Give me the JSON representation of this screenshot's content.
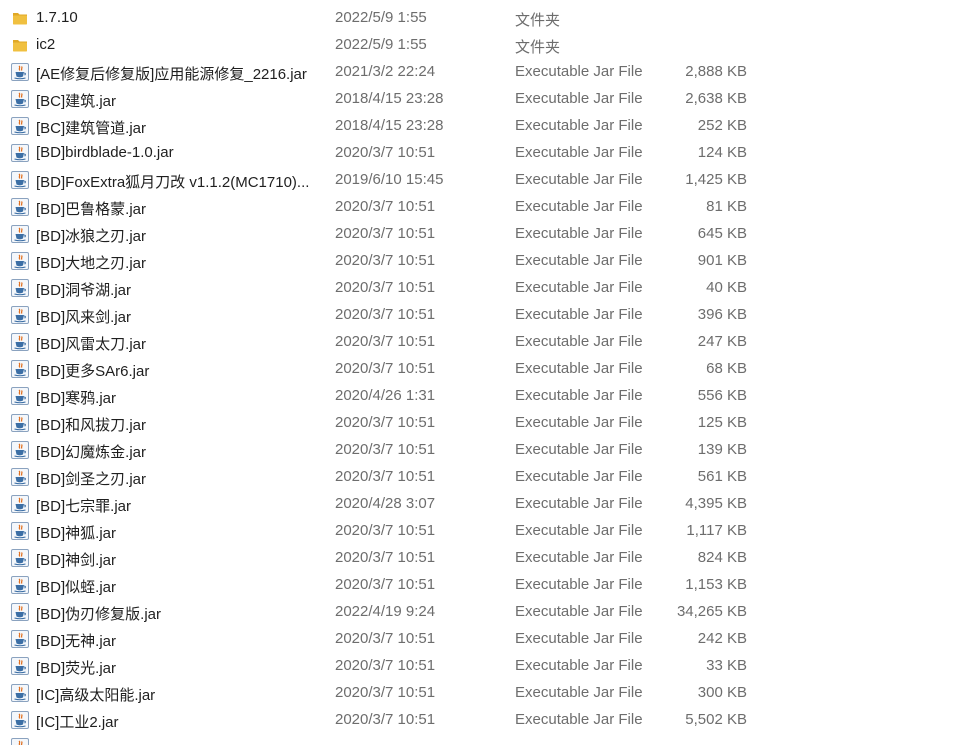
{
  "icons": {
    "folder": "folder-icon",
    "jar": "java-jar-icon"
  },
  "colors": {
    "folder_yellow": "#f0c040",
    "jar_blue": "#3b6ea5",
    "jar_orange": "#e07020",
    "secondary_text": "#6d6d6d"
  },
  "files": [
    {
      "name": "1.7.10",
      "date": "2022/5/9 1:55",
      "type": "文件夹",
      "size": "",
      "icon": "folder"
    },
    {
      "name": "ic2",
      "date": "2022/5/9 1:55",
      "type": "文件夹",
      "size": "",
      "icon": "folder"
    },
    {
      "name": "[AE修复后修复版]应用能源修复_2216.jar",
      "date": "2021/3/2 22:24",
      "type": "Executable Jar File",
      "size": "2,888 KB",
      "icon": "jar"
    },
    {
      "name": "[BC]建筑.jar",
      "date": "2018/4/15 23:28",
      "type": "Executable Jar File",
      "size": "2,638 KB",
      "icon": "jar"
    },
    {
      "name": "[BC]建筑管道.jar",
      "date": "2018/4/15 23:28",
      "type": "Executable Jar File",
      "size": "252 KB",
      "icon": "jar"
    },
    {
      "name": "[BD]birdblade-1.0.jar",
      "date": "2020/3/7 10:51",
      "type": "Executable Jar File",
      "size": "124 KB",
      "icon": "jar"
    },
    {
      "name": "[BD]FoxExtra狐月刀改 v1.1.2(MC1710)...",
      "date": "2019/6/10 15:45",
      "type": "Executable Jar File",
      "size": "1,425 KB",
      "icon": "jar"
    },
    {
      "name": "[BD]巴鲁格蒙.jar",
      "date": "2020/3/7 10:51",
      "type": "Executable Jar File",
      "size": "81 KB",
      "icon": "jar"
    },
    {
      "name": "[BD]冰狼之刃.jar",
      "date": "2020/3/7 10:51",
      "type": "Executable Jar File",
      "size": "645 KB",
      "icon": "jar"
    },
    {
      "name": "[BD]大地之刃.jar",
      "date": "2020/3/7 10:51",
      "type": "Executable Jar File",
      "size": "901 KB",
      "icon": "jar"
    },
    {
      "name": "[BD]洞爷湖.jar",
      "date": "2020/3/7 10:51",
      "type": "Executable Jar File",
      "size": "40 KB",
      "icon": "jar"
    },
    {
      "name": "[BD]风来剑.jar",
      "date": "2020/3/7 10:51",
      "type": "Executable Jar File",
      "size": "396 KB",
      "icon": "jar"
    },
    {
      "name": "[BD]风雷太刀.jar",
      "date": "2020/3/7 10:51",
      "type": "Executable Jar File",
      "size": "247 KB",
      "icon": "jar"
    },
    {
      "name": "[BD]更多SAr6.jar",
      "date": "2020/3/7 10:51",
      "type": "Executable Jar File",
      "size": "68 KB",
      "icon": "jar"
    },
    {
      "name": "[BD]寒鸦.jar",
      "date": "2020/4/26 1:31",
      "type": "Executable Jar File",
      "size": "556 KB",
      "icon": "jar"
    },
    {
      "name": "[BD]和风拔刀.jar",
      "date": "2020/3/7 10:51",
      "type": "Executable Jar File",
      "size": "125 KB",
      "icon": "jar"
    },
    {
      "name": "[BD]幻魔炼金.jar",
      "date": "2020/3/7 10:51",
      "type": "Executable Jar File",
      "size": "139 KB",
      "icon": "jar"
    },
    {
      "name": "[BD]剑圣之刃.jar",
      "date": "2020/3/7 10:51",
      "type": "Executable Jar File",
      "size": "561 KB",
      "icon": "jar"
    },
    {
      "name": "[BD]七宗罪.jar",
      "date": "2020/4/28 3:07",
      "type": "Executable Jar File",
      "size": "4,395 KB",
      "icon": "jar"
    },
    {
      "name": "[BD]神狐.jar",
      "date": "2020/3/7 10:51",
      "type": "Executable Jar File",
      "size": "1,117 KB",
      "icon": "jar"
    },
    {
      "name": "[BD]神剑.jar",
      "date": "2020/3/7 10:51",
      "type": "Executable Jar File",
      "size": "824 KB",
      "icon": "jar"
    },
    {
      "name": "[BD]似蛭.jar",
      "date": "2020/3/7 10:51",
      "type": "Executable Jar File",
      "size": "1,153 KB",
      "icon": "jar"
    },
    {
      "name": "[BD]伪刃修复版.jar",
      "date": "2022/4/19 9:24",
      "type": "Executable Jar File",
      "size": "34,265 KB",
      "icon": "jar"
    },
    {
      "name": "[BD]无神.jar",
      "date": "2020/3/7 10:51",
      "type": "Executable Jar File",
      "size": "242 KB",
      "icon": "jar"
    },
    {
      "name": "[BD]荧光.jar",
      "date": "2020/3/7 10:51",
      "type": "Executable Jar File",
      "size": "33 KB",
      "icon": "jar"
    },
    {
      "name": "[IC]高级太阳能.jar",
      "date": "2020/3/7 10:51",
      "type": "Executable Jar File",
      "size": "300 KB",
      "icon": "jar"
    },
    {
      "name": "[IC]工业2.jar",
      "date": "2020/3/7 10:51",
      "type": "Executable Jar File",
      "size": "5,502 KB",
      "icon": "jar"
    },
    {
      "name": "",
      "date": "",
      "type": "",
      "size": "",
      "icon": "jar"
    }
  ]
}
